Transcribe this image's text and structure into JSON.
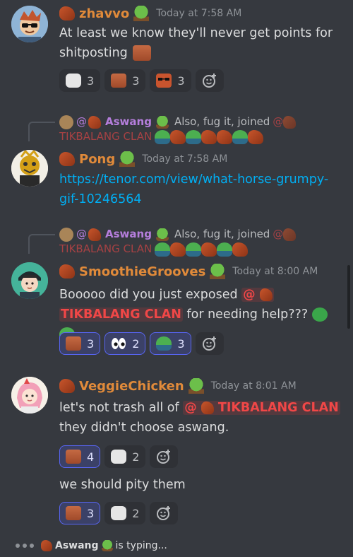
{
  "messages": [
    {
      "username": "zhavvo",
      "timestamp": "Today at 7:58 AM",
      "text_lines": [
        "At least we know they'll never get points for",
        "shitposting"
      ],
      "reactions": [
        {
          "emoji": "meme-face",
          "count": "3",
          "me": false
        },
        {
          "emoji": "orange-face",
          "count": "3",
          "me": false
        },
        {
          "emoji": "sunglasses-face",
          "count": "3",
          "me": false
        }
      ]
    },
    {
      "reply": {
        "author": "Aswang",
        "text_prefix": "Also, fug it, joined",
        "mention": "TIKBALANG CLAN"
      },
      "username": "Pong",
      "timestamp": "Today at 7:58 AM",
      "link_lines": [
        "https://tenor.com/view/what-horse-grumpy-",
        "gif-10246564"
      ]
    },
    {
      "reply": {
        "author": "Aswang",
        "text_prefix": "Also, fug it, joined",
        "mention": "TIKBALANG CLAN"
      },
      "username": "SmoothieGrooves",
      "timestamp": "Today at 8:00 AM",
      "text_before_mention": "Booooo did you just exposed",
      "mention_at": "@",
      "mention": "TIKBALANG CLAN",
      "text_after_mention": "for needing help???",
      "reactions": [
        {
          "emoji": "orange-face",
          "count": "3",
          "me": true
        },
        {
          "emoji": "eyes",
          "count": "2",
          "me": true
        },
        {
          "emoji": "peepo",
          "count": "3",
          "me": true
        }
      ]
    },
    {
      "username": "VeggieChicken",
      "timestamp": "Today at 8:01 AM",
      "text_before_mention": "let's not trash all of",
      "mention_at": "@",
      "mention": "TIKBALANG CLAN",
      "text_line2": "they didn't choose aswang.",
      "reactions": [
        {
          "emoji": "orange-face",
          "count": "4",
          "me": true
        },
        {
          "emoji": "meme-face",
          "count": "2",
          "me": false
        }
      ],
      "followup_text": "we should pity them",
      "followup_reactions": [
        {
          "emoji": "orange-face",
          "count": "3",
          "me": true
        },
        {
          "emoji": "meme-face",
          "count": "2",
          "me": false
        }
      ]
    }
  ],
  "typing": {
    "user": "Aswang",
    "suffix": "is typing..."
  },
  "colors": {
    "background": "#36393f",
    "username": "#e08a3a",
    "mention": "#f04747",
    "link": "#00aff4",
    "reply_name": "#b57edc"
  }
}
